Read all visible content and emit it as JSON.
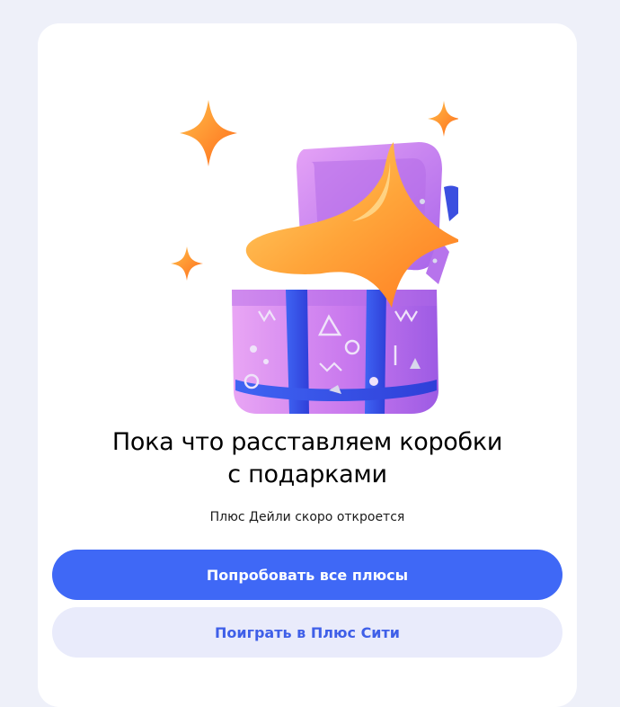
{
  "promo": {
    "illustration_icon": "gift-box-with-stars-icon",
    "title_line1": "Пока что расставляем коробки",
    "title_line2": "с подарками",
    "subtitle": "Плюс Дейли скоро откроется",
    "primary_button": "Попробовать все плюсы",
    "secondary_button": "Поиграть в Плюс Сити"
  },
  "colors": {
    "page_background": "#eef0f9",
    "card_background": "#ffffff",
    "primary_button": "#3f68f6",
    "secondary_button": "#e9ebfb",
    "secondary_text": "#3f5fe8"
  }
}
